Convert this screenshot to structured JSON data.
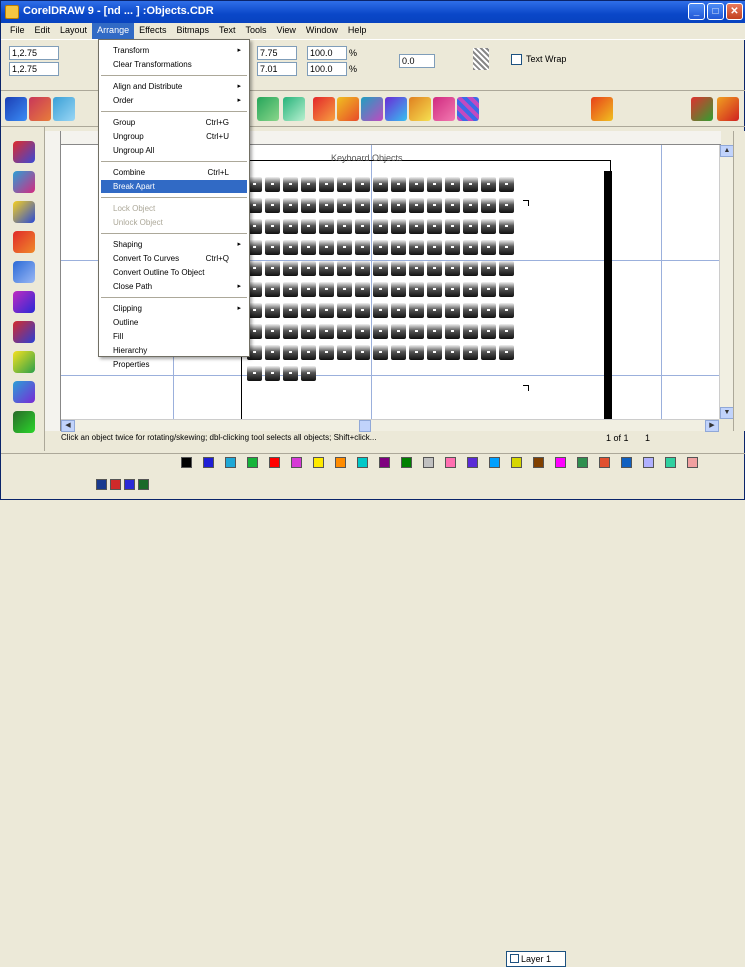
{
  "window": {
    "title": "CorelDRAW 9 - [nd ... ] :Objects.CDR",
    "min_label": "_",
    "max_label": "□",
    "close_label": "✕"
  },
  "menubar": {
    "items": [
      "File",
      "Edit",
      "Layout",
      "Arrange",
      "Effects",
      "Bitmaps",
      "Text",
      "Tools",
      "View",
      "Window",
      "Help"
    ],
    "active_index": 3
  },
  "propbar": {
    "pos_x": "1,2.75",
    "pos_y": "1,2.75",
    "w": "7.75",
    "h": "7.01",
    "scale_w": "100.0",
    "scale_h": "100.0",
    "angle": "0.0",
    "unit_w": "%",
    "unit_h": "%",
    "wrap_label": "Text Wrap"
  },
  "arrange_menu": {
    "items": [
      {
        "label": "Transform",
        "shortcut": "",
        "arrow": "▸",
        "state": "normal"
      },
      {
        "label": "Clear Transformations",
        "shortcut": "",
        "arrow": "",
        "state": "normal"
      },
      {
        "label": "Align and Distribute",
        "shortcut": "",
        "arrow": "▸",
        "state": "normal"
      },
      {
        "label": "Order",
        "shortcut": "",
        "arrow": "▸",
        "state": "normal"
      },
      {
        "label": "Group",
        "shortcut": "Ctrl+G",
        "arrow": "",
        "state": "normal"
      },
      {
        "label": "Ungroup",
        "shortcut": "Ctrl+U",
        "arrow": "",
        "state": "normal"
      },
      {
        "label": "Ungroup All",
        "shortcut": "",
        "arrow": "",
        "state": "normal"
      },
      {
        "label": "Combine",
        "shortcut": "Ctrl+L",
        "arrow": "",
        "state": "normal"
      },
      {
        "label": "Break Apart",
        "shortcut": "",
        "arrow": "",
        "state": "highlight"
      },
      {
        "label": "Lock Object",
        "shortcut": "",
        "arrow": "",
        "state": "disabled"
      },
      {
        "label": "Unlock Object",
        "shortcut": "",
        "arrow": "",
        "state": "disabled"
      },
      {
        "label": "Shaping",
        "shortcut": "",
        "arrow": "▸",
        "state": "normal"
      },
      {
        "label": "Convert To Curves",
        "shortcut": "Ctrl+Q",
        "arrow": "",
        "state": "normal"
      },
      {
        "label": "Convert Outline To Object",
        "shortcut": "",
        "arrow": "",
        "state": "normal"
      },
      {
        "label": "Close Path",
        "shortcut": "",
        "arrow": "▸",
        "state": "normal"
      }
    ],
    "lower_items": [
      {
        "label": "Clipping",
        "arrow": "▸",
        "state": "normal"
      },
      {
        "label": "Outline",
        "arrow": "",
        "state": "normal"
      },
      {
        "label": "Fill",
        "arrow": "",
        "state": "normal"
      },
      {
        "label": "Hierarchy",
        "arrow": "",
        "state": "normal"
      },
      {
        "label": "Properties",
        "arrow": "",
        "state": "normal"
      }
    ]
  },
  "canvas": {
    "page_title": "Keyboard Objects"
  },
  "statusbar": {
    "text": "Click an object twice for rotating/skewing; dbl-clicking tool selects all objects; Shift+click...",
    "page_label": "1 of 1",
    "page_num": "1"
  },
  "layer": {
    "name": "Layer 1"
  },
  "colors": {
    "accent": "#316ac5",
    "titlebar": "#0a47c8",
    "swatches": [
      "#000000",
      "#1f1fd6",
      "#1fa8d6",
      "#16b33a",
      "#ff0000",
      "#d63ad6",
      "#ffea00",
      "#ff8c00",
      "#00c8c8",
      "#7f007f",
      "#007f00",
      "#c0c0c0",
      "#ff6fb0",
      "#5a2bd6",
      "#00a0ff",
      "#d6d600",
      "#804000",
      "#ff00ff",
      "#2f8f4f",
      "#e05030",
      "#1060c0",
      "#b0b0ff",
      "#30d0a0",
      "#f0a0a0"
    ]
  }
}
